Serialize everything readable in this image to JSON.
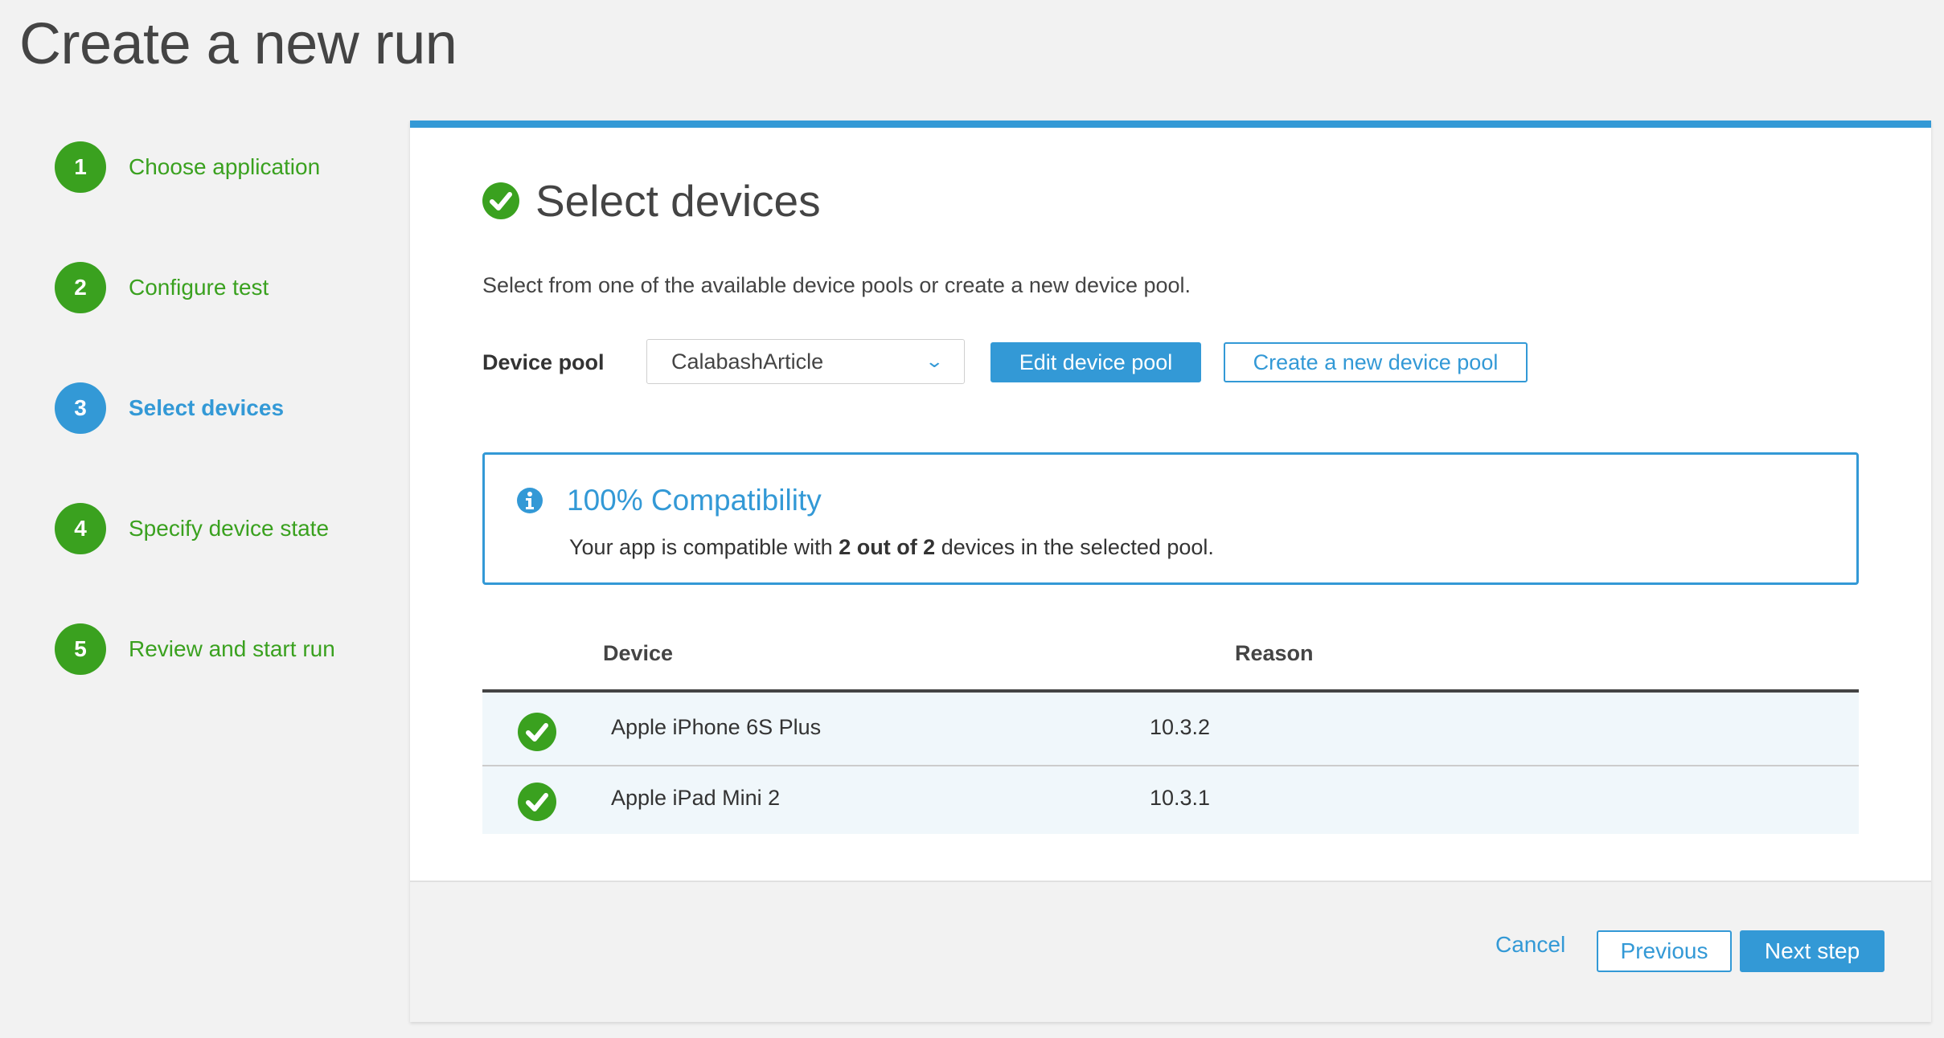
{
  "page": {
    "title": "Create a new run"
  },
  "steps": [
    {
      "number": "1",
      "label": "Choose application",
      "state": "complete"
    },
    {
      "number": "2",
      "label": "Configure test",
      "state": "complete"
    },
    {
      "number": "3",
      "label": "Select devices",
      "state": "active"
    },
    {
      "number": "4",
      "label": "Specify device state",
      "state": "complete"
    },
    {
      "number": "5",
      "label": "Review and start run",
      "state": "complete"
    }
  ],
  "panel": {
    "heading": "Select devices",
    "description": "Select from one of the available device pools or create a new device pool.",
    "device_pool": {
      "label": "Device pool",
      "selected": "CalabashArticle",
      "edit_label": "Edit device pool",
      "create_label": "Create a new device pool"
    },
    "compatibility": {
      "title": "100% Compatibility",
      "text_prefix": "Your app is compatible with ",
      "text_bold": "2 out of 2",
      "text_suffix": " devices in the selected pool."
    },
    "table": {
      "columns": [
        "Device",
        "Reason"
      ],
      "rows": [
        {
          "status": "compatible",
          "device": "Apple iPhone 6S Plus",
          "reason": "10.3.2"
        },
        {
          "status": "compatible",
          "device": "Apple iPad Mini 2",
          "reason": "10.3.1"
        }
      ]
    }
  },
  "footer": {
    "cancel_label": "Cancel",
    "previous_label": "Previous",
    "next_label": "Next step"
  },
  "colors": {
    "accent": "#3399d6",
    "success": "#3aa11f",
    "text": "#444444",
    "background": "#f2f2f2"
  }
}
